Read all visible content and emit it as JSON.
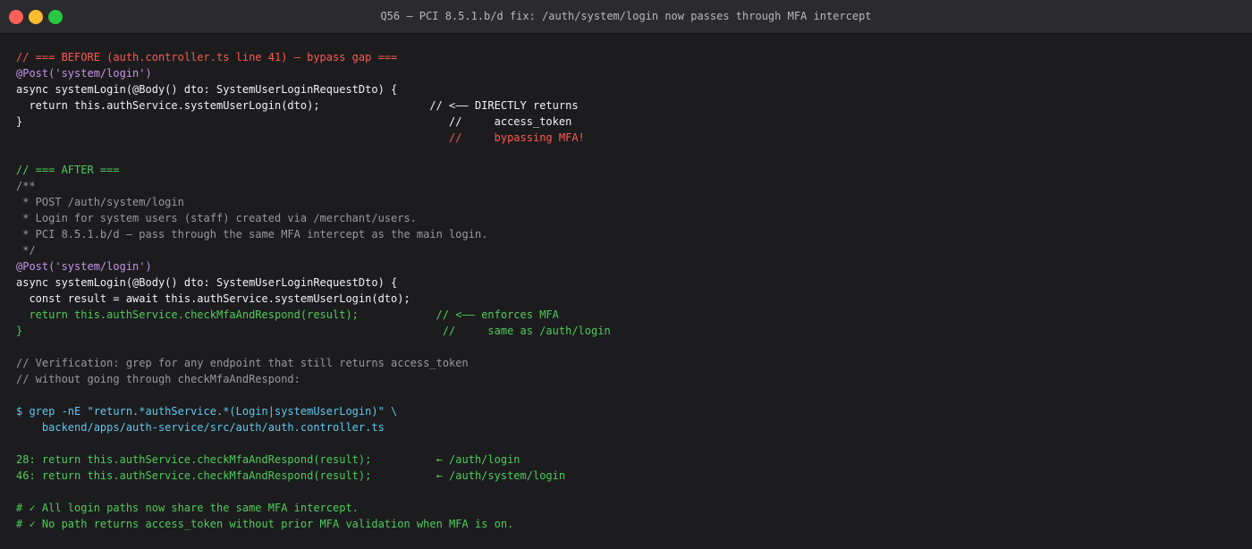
{
  "window": {
    "title": "Q56 — PCI 8.5.1.b/d fix: /auth/system/login now passes through MFA intercept"
  },
  "code_lines": [
    {
      "text": "// === BEFORE (auth.controller.ts line 41) — bypass gap ===",
      "color": "red"
    },
    {
      "text": "@Post('system/login')",
      "color": "purple"
    },
    {
      "text": "async systemLogin(@Body() dto: SystemUserLoginRequestDto) {",
      "color": "white"
    },
    {
      "text": "  return this.authService.systemUserLogin(dto);                 // <—— DIRECTLY returns",
      "color": "white"
    },
    {
      "text": "}                                                                  //     access_token",
      "color": "white"
    },
    {
      "text": "                                                                   //     bypassing MFA!",
      "color": "red"
    },
    {
      "text": "",
      "color": "white"
    },
    {
      "text": "// === AFTER ===",
      "color": "green"
    },
    {
      "text": "/**",
      "color": "gray"
    },
    {
      "text": " * POST /auth/system/login",
      "color": "gray"
    },
    {
      "text": " * Login for system users (staff) created via /merchant/users.",
      "color": "gray"
    },
    {
      "text": " * PCI 8.5.1.b/d — pass through the same MFA intercept as the main login.",
      "color": "gray"
    },
    {
      "text": " */",
      "color": "gray"
    },
    {
      "text": "@Post('system/login')",
      "color": "purple"
    },
    {
      "text": "async systemLogin(@Body() dto: SystemUserLoginRequestDto) {",
      "color": "white"
    },
    {
      "text": "  const result = await this.authService.systemUserLogin(dto);",
      "color": "white"
    },
    {
      "text": "  return this.authService.checkMfaAndRespond(result);            // <—— enforces MFA",
      "color": "green"
    },
    {
      "text": "}                                                                 //     same as /auth/login",
      "color": "green"
    },
    {
      "text": "",
      "color": "white"
    },
    {
      "text": "// Verification: grep for any endpoint that still returns access_token",
      "color": "gray"
    },
    {
      "text": "// without going through checkMfaAndRespond:",
      "color": "gray"
    },
    {
      "text": "",
      "color": "white"
    },
    {
      "text": "$ grep -nE \"return.*authService.*(Login|systemUserLogin)\" \\",
      "color": "cyan"
    },
    {
      "text": "    backend/apps/auth-service/src/auth/auth.controller.ts",
      "color": "cyan"
    },
    {
      "text": "",
      "color": "white"
    },
    {
      "text": "28: return this.authService.checkMfaAndRespond(result);          ← /auth/login",
      "color": "green"
    },
    {
      "text": "46: return this.authService.checkMfaAndRespond(result);          ← /auth/system/login",
      "color": "green"
    },
    {
      "text": "",
      "color": "white"
    },
    {
      "text": "# ✓ All login paths now share the same MFA intercept.",
      "color": "green"
    },
    {
      "text": "# ✓ No path returns access_token without prior MFA validation when MFA is on.",
      "color": "green"
    }
  ]
}
